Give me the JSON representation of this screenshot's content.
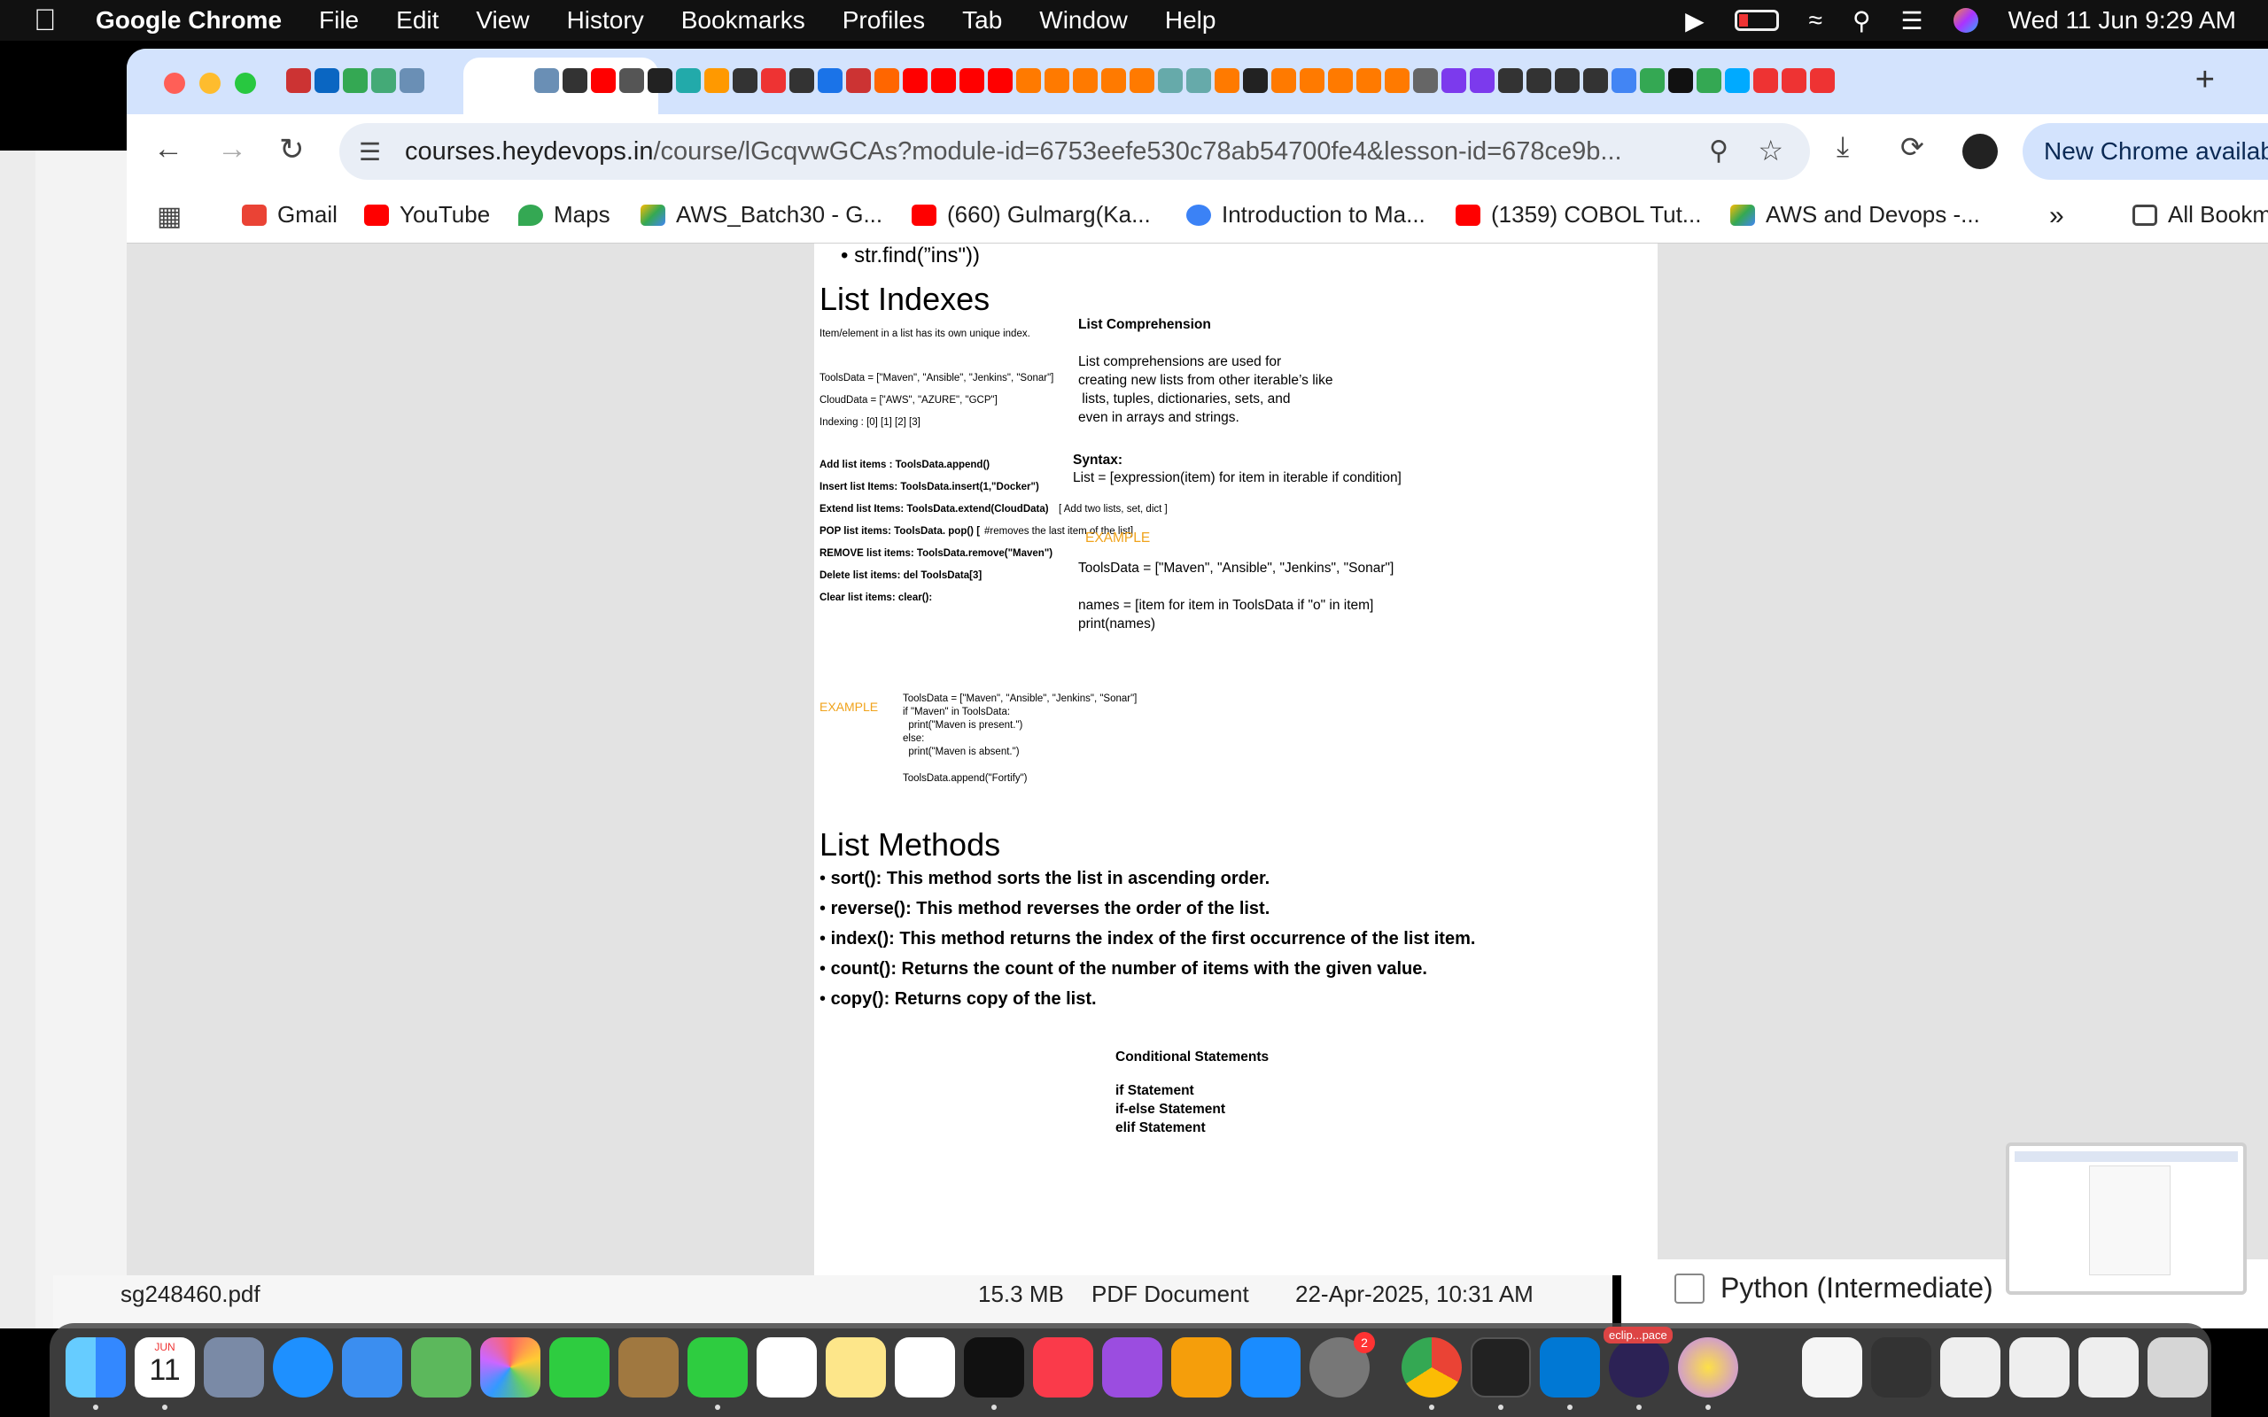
{
  "menubar": {
    "app_name": "Google Chrome",
    "items": [
      "File",
      "Edit",
      "View",
      "History",
      "Bookmarks",
      "Profiles",
      "Tab",
      "Window",
      "Help"
    ],
    "datetime": "Wed 11 Jun  9:29 AM"
  },
  "browser": {
    "url_host": "courses.heydevops.in",
    "url_path": "/course/lGcqvwGCAs?module-id=6753eefe530c78ab54700fe4&lesson-id=678ce9b...",
    "new_chrome_label": "New Chrome availab",
    "bookmarks": [
      "Gmail",
      "YouTube",
      "Maps",
      "AWS_Batch30 - G...",
      "(660) Gulmarg(Ka...",
      "Introduction to Ma...",
      "(1359) COBOL Tut...",
      "AWS and Devops -..."
    ],
    "all_bookmarks_label": "All Bookm"
  },
  "doc": {
    "prev_bullet": "str.find(”ins\"))",
    "list_indexes": {
      "title": "List Indexes",
      "intro": "Item/element in a list has its own unique index.",
      "tools_data": "ToolsData = [\"Maven\", \"Ansible\", \"Jenkins\", \"Sonar\"]",
      "cloud_data": "CloudData = [\"AWS\", \"AZURE\", \"GCP\"]",
      "indexing": "Indexing : [0] [1] [2] [3]",
      "ops": [
        {
          "label": "Add list items :  ToolsData.append()",
          "note": ""
        },
        {
          "label": "Insert list Items: ToolsData.insert(1,\"Docker\")",
          "note": ""
        },
        {
          "label": "Extend list Items: ToolsData.extend(CloudData)",
          "note": "[ Add two lists, set, dict ]"
        },
        {
          "label": "POP list items: ToolsData. pop() [",
          "note": "#removes the last item of the list]"
        },
        {
          "label": "REMOVE list items: ToolsData.remove(\"Maven\")",
          "note": ""
        },
        {
          "label": "Delete list items: del ToolsData[3]",
          "note": ""
        },
        {
          "label": "Clear list items: clear():",
          "note": ""
        }
      ],
      "example_label": "EXAMPLE",
      "example_code": [
        "ToolsData = [\"Maven\", \"Ansible\", \"Jenkins\", \"Sonar\"]",
        "if \"Maven\" in ToolsData:",
        "  print(\"Maven is present.\")",
        "else:",
        "  print(\"Maven is absent.\")",
        "",
        "ToolsData.append(\"Fortify\")"
      ]
    },
    "list_comprehension": {
      "title": "List Comprehension",
      "desc": [
        "List comprehensions are used for",
        "creating new lists from other iterable’s like",
        " lists, tuples, dictionaries, sets, and",
        "even in arrays and strings."
      ],
      "syntax_label": "Syntax:",
      "syntax": "List = [expression(item) for item in iterable if condition]",
      "example_label": "EXAMPLE",
      "example_line1": "ToolsData = [\"Maven\", \"Ansible\", \"Jenkins\", \"Sonar\"]",
      "example_line2": "names = [item for item in ToolsData if \"o\" in item]",
      "example_line3": "print(names)"
    },
    "list_methods": {
      "title": "List Methods",
      "items": [
        "sort(): This method sorts the list in ascending order.",
        "reverse(): This method reverses the order of the list.",
        "index(): This method returns the index of the first occurrence of the list item.",
        "count(): Returns the count of the number of items with the given value.",
        "copy(): Returns copy of the list."
      ]
    },
    "conditional": {
      "title": "Conditional Statements",
      "items": [
        "if Statement",
        "if-else Statement",
        "elif Statement"
      ]
    }
  },
  "finder": {
    "file_name": "sg248460.pdf",
    "file_size": "15.3 MB",
    "file_kind": "PDF Document",
    "file_date": "22-Apr-2025, 10:31 AM"
  },
  "background_page": {
    "challenge_title": "Python (Intermediate)"
  },
  "dock": {
    "calendar_month": "JUN",
    "calendar_day": "11",
    "badge_count": "2",
    "eclipse_label": "eclip...pace"
  }
}
